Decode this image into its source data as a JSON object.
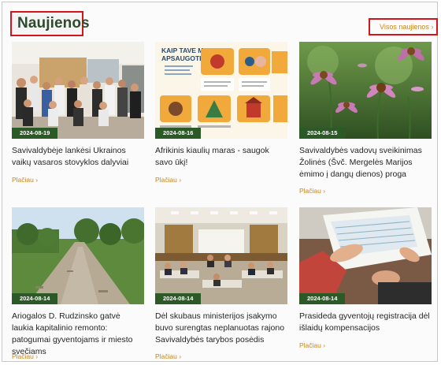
{
  "section": {
    "title": "Naujienos",
    "all_news_link": "Visos naujienos ›"
  },
  "read_more_label": "Plačiau ›",
  "poster": {
    "heading_line1": "KAIP TAVE MAN",
    "heading_line2": "APSAUGOTI?"
  },
  "news": [
    {
      "date": "2024-08-19",
      "title": "Savivaldybėje lankėsi Ukrainos vaikų vasaros stovyklos dalyviai"
    },
    {
      "date": "2024-08-16",
      "title": "Afrikinis kiaulių maras - saugok savo ūkį!"
    },
    {
      "date": "2024-08-15",
      "title": "Savivaldybės vadovų sveikinimas Žolinės (Švč. Mergelės Marijos ėmimo į dangų dienos) proga"
    },
    {
      "date": "2024-08-14",
      "title": "Ariogalos D. Rudzinsko gatvė laukia kapitalinio remonto: patogumai gyventojams ir miesto svečiams"
    },
    {
      "date": "2024-08-14",
      "title": "Dėl skubaus ministerijos įsakymo buvo surengtas neplanuotas rajono Savivaldybės tarybos posėdis"
    },
    {
      "date": "2024-08-14",
      "title": "Prasideda gyventojų registracija dėl išlaidų kompensacijos"
    }
  ]
}
